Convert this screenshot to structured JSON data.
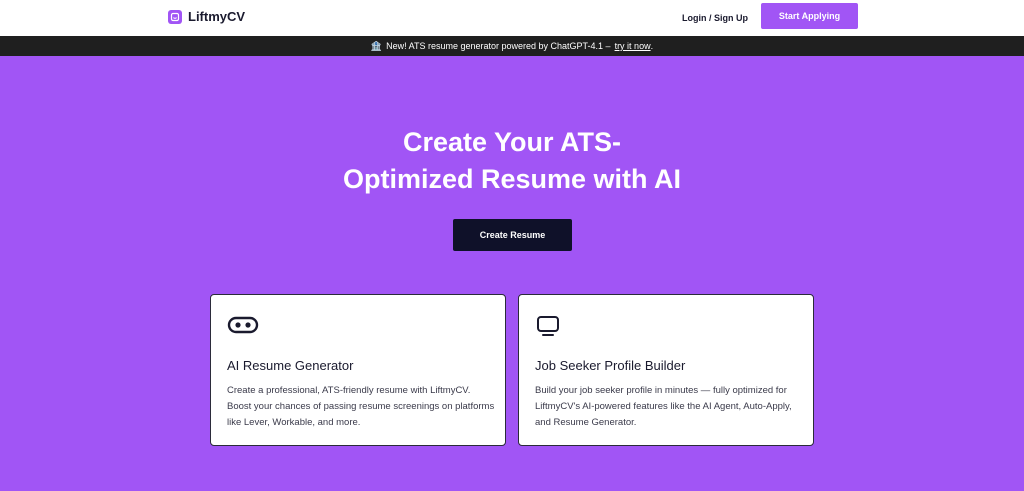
{
  "header": {
    "logo_text": "LiftmyCV",
    "login_label": "Login / Sign Up",
    "start_label": "Start Applying"
  },
  "announcement": {
    "icon": "🏦",
    "text": "New! ATS resume generator powered by ChatGPT-4.1 –",
    "link_label": "try it now",
    "suffix": "."
  },
  "hero": {
    "title_line1": "Create Your ATS-",
    "title_line2": "Optimized Resume with AI",
    "cta_label": "Create Resume"
  },
  "cards": [
    {
      "icon": "robot-face-icon",
      "title": "AI Resume Generator",
      "description": "Create a professional, ATS-friendly resume with LiftmyCV. Boost your chances of passing resume screenings on platforms like Lever, Workable, and more."
    },
    {
      "icon": "monitor-icon",
      "title": "Job Seeker Profile Builder",
      "description": "Build your job seeker profile in minutes — fully optimized for LiftmyCV's AI-powered features like the AI Agent, Auto-Apply, and Resume Generator."
    }
  ],
  "colors": {
    "brand_purple": "#a155f5",
    "dark_navy": "#0f1129",
    "announcement_bg": "#1f1f1f"
  }
}
